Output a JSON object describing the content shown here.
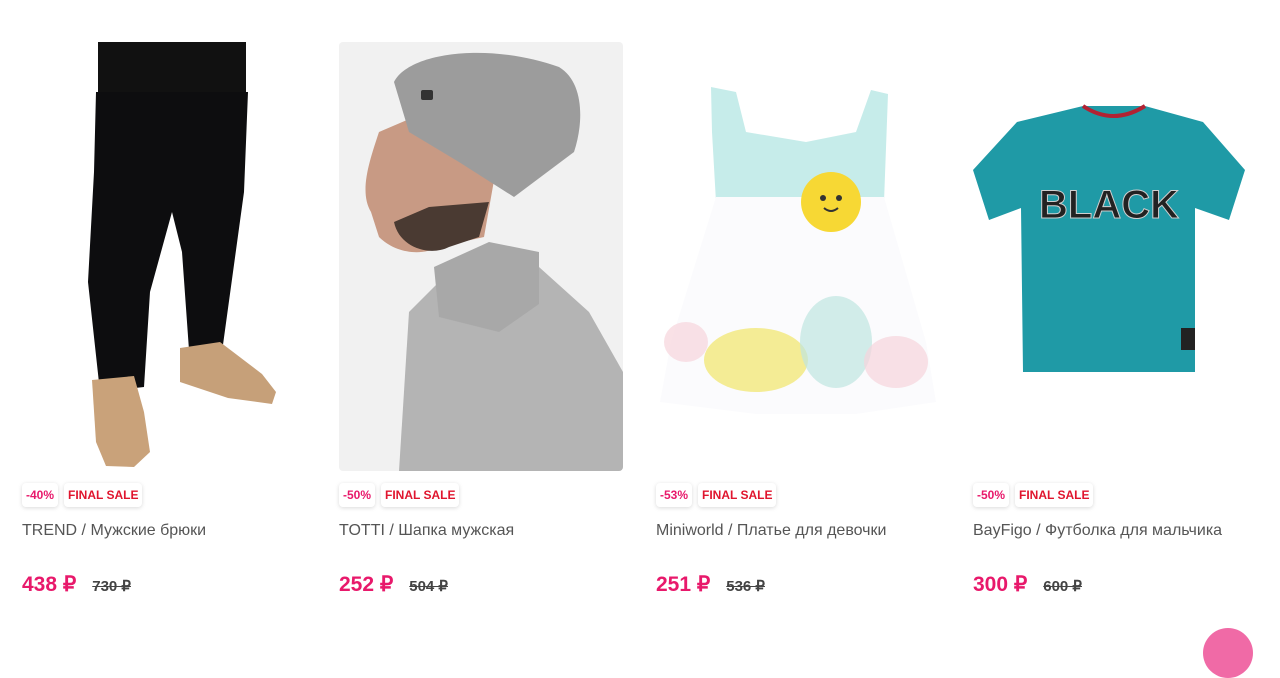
{
  "products": [
    {
      "discount": "-40%",
      "sale_label": "FINAL SALE",
      "title": "TREND / Мужские брюки",
      "price": "438 ₽",
      "old_price": "730 ₽",
      "image": "mens-trousers-image"
    },
    {
      "discount": "-50%",
      "sale_label": "FINAL SALE",
      "title": "TOTTI / Шапка мужская",
      "price": "252 ₽",
      "old_price": "504 ₽",
      "image": "mens-hat-image"
    },
    {
      "discount": "-53%",
      "sale_label": "FINAL SALE",
      "title": "Miniworld / Платье для девочки",
      "price": "251 ₽",
      "old_price": "536 ₽",
      "image": "girls-dress-image"
    },
    {
      "discount": "-50%",
      "sale_label": "FINAL SALE",
      "title": "BayFigo / Футболка для мальчика",
      "price": "300 ₽",
      "old_price": "600 ₽",
      "image": "boys-tshirt-image"
    }
  ],
  "tshirt_print": "BLACK",
  "colors": {
    "accent": "#e8196b",
    "sale_red": "#e0152e"
  }
}
